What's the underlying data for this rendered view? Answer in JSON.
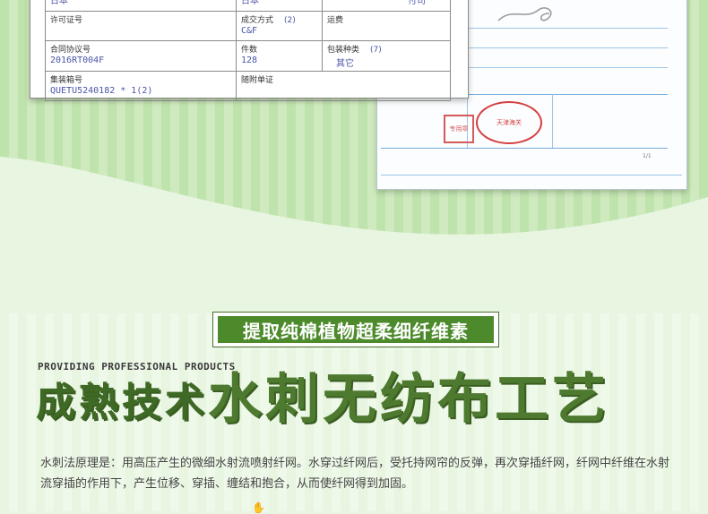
{
  "form": {
    "country_left": "日本",
    "country_right": "日本",
    "top_extra": "付司",
    "license_label": "许可证号",
    "deal_label": "成交方式",
    "deal_num": "(2)",
    "deal_value": "C&F",
    "freight_label": "运费",
    "contract_label": "合同协议号",
    "contract_value": "2016RT004F",
    "pieces_label": "件数",
    "pieces_value": "128",
    "pack_label": "包装种类",
    "pack_num": "(7)",
    "pack_value": "其它",
    "container_label": "集装箱号",
    "container_value": "QUETU5240182 * 1(2)",
    "docs_label": "随附单证"
  },
  "doc": {
    "stamp_text": "天津海关",
    "stamp2_text": "专用章",
    "page_no": "1/1"
  },
  "subtitle": "提取纯棉植物超柔细纤维素",
  "english_tag": "PROVIDING PROFESSIONAL PRODUCTS",
  "title_part1": "成熟技术",
  "title_part2": "水刺无纺布工艺",
  "description": "水刺法原理是：用高压产生的微细水射流喷射纤网。水穿过纤网后，受托持网帘的反弹，再次穿插纤网，纤网中纤维在水射流穿插的作用下，产生位移、穿插、缠结和抱合，从而使纤网得到加固。",
  "colors": {
    "accent": "#4e7a2f",
    "subtitle_bg": "#4d8a2c",
    "band_green": "#bfe3ad"
  }
}
